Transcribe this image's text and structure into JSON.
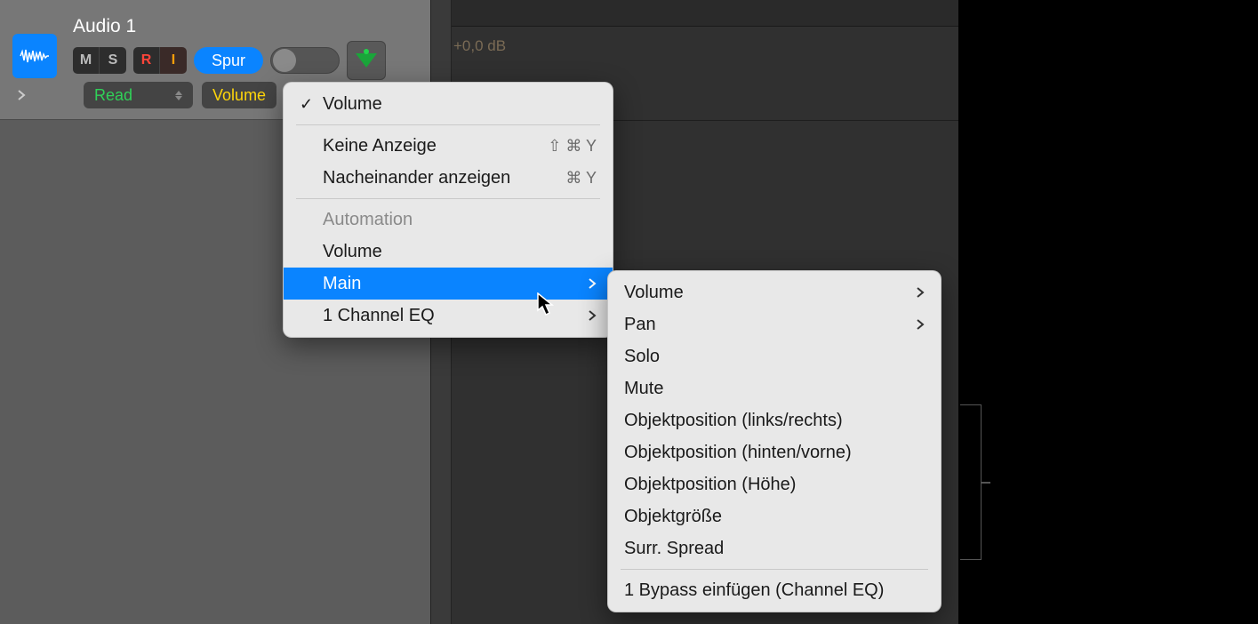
{
  "track": {
    "name": "Audio 1",
    "buttons": {
      "m": "M",
      "s": "S",
      "r": "R",
      "i": "I"
    },
    "spur_label": "Spur",
    "indicator": "green-triangle"
  },
  "automation_row": {
    "mode_label": "Read",
    "param_label": "Volume"
  },
  "timeline": {
    "db_text": "+0,0 dB"
  },
  "menu_primary": {
    "checked_item": "Volume",
    "no_display": {
      "label": "Keine Anzeige",
      "shortcut": "⇧ ⌘ Y"
    },
    "cycle_display": {
      "label": "Nacheinander anzeigen",
      "shortcut": "⌘ Y"
    },
    "section_header": "Automation",
    "items": {
      "volume": "Volume",
      "main": "Main",
      "channel_eq": "1 Channel EQ"
    }
  },
  "menu_sub": {
    "items": {
      "volume": "Volume",
      "pan": "Pan",
      "solo": "Solo",
      "mute": "Mute",
      "obj_lr": "Objektposition (links/rechts)",
      "obj_fb": "Objektposition (hinten/vorne)",
      "obj_h": "Objektposition (Höhe)",
      "obj_size": "Objektgröße",
      "surr_spread": "Surr. Spread",
      "bypass": "1 Bypass einfügen (Channel EQ)"
    }
  }
}
